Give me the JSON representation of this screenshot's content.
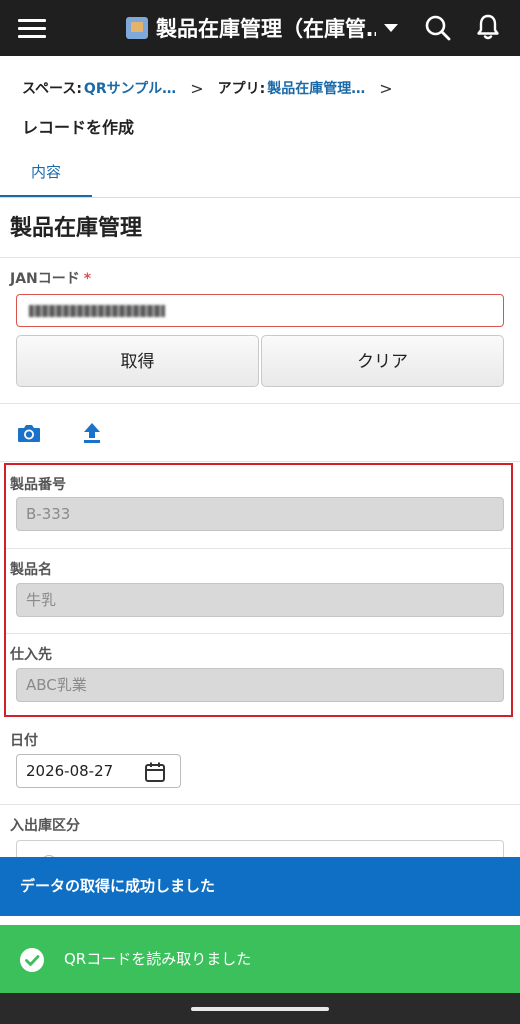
{
  "header": {
    "app_title": "製品在庫管理（在庫管…",
    "icons": [
      "menu-icon",
      "app-icon",
      "dropdown-caret-icon",
      "search-icon",
      "bell-icon"
    ]
  },
  "breadcrumb": {
    "space_label": "スペース:",
    "space_link": "QRサンプル…",
    "app_label": "アプリ:",
    "app_link": "製品在庫管理…"
  },
  "page": {
    "heading": "レコードを作成",
    "tabs": [
      {
        "label": "内容"
      }
    ],
    "form_title": "製品在庫管理"
  },
  "form": {
    "jan": {
      "label": "JANコード",
      "required_mark": "*"
    },
    "buttons": {
      "get": "取得",
      "clear": "クリア"
    },
    "product_number": {
      "label": "製品番号",
      "value": "B-333"
    },
    "product_name": {
      "label": "製品名",
      "value": "牛乳"
    },
    "supplier": {
      "label": "仕入先",
      "value": "ABC乳業"
    },
    "date": {
      "label": "日付",
      "value": "2026-08-27"
    },
    "in_out": {
      "label": "入出庫区分"
    }
  },
  "toasts": {
    "success": "データの取得に成功しました",
    "qr": "QRコードを読み取りました"
  },
  "colors": {
    "header_bg": "#1f1f1f",
    "accent_blue": "#1b6aa8",
    "toast_blue": "#0f6fc5",
    "toast_green": "#3cc05c",
    "highlight_red": "#d0212b",
    "required_red": "#d9534f"
  }
}
